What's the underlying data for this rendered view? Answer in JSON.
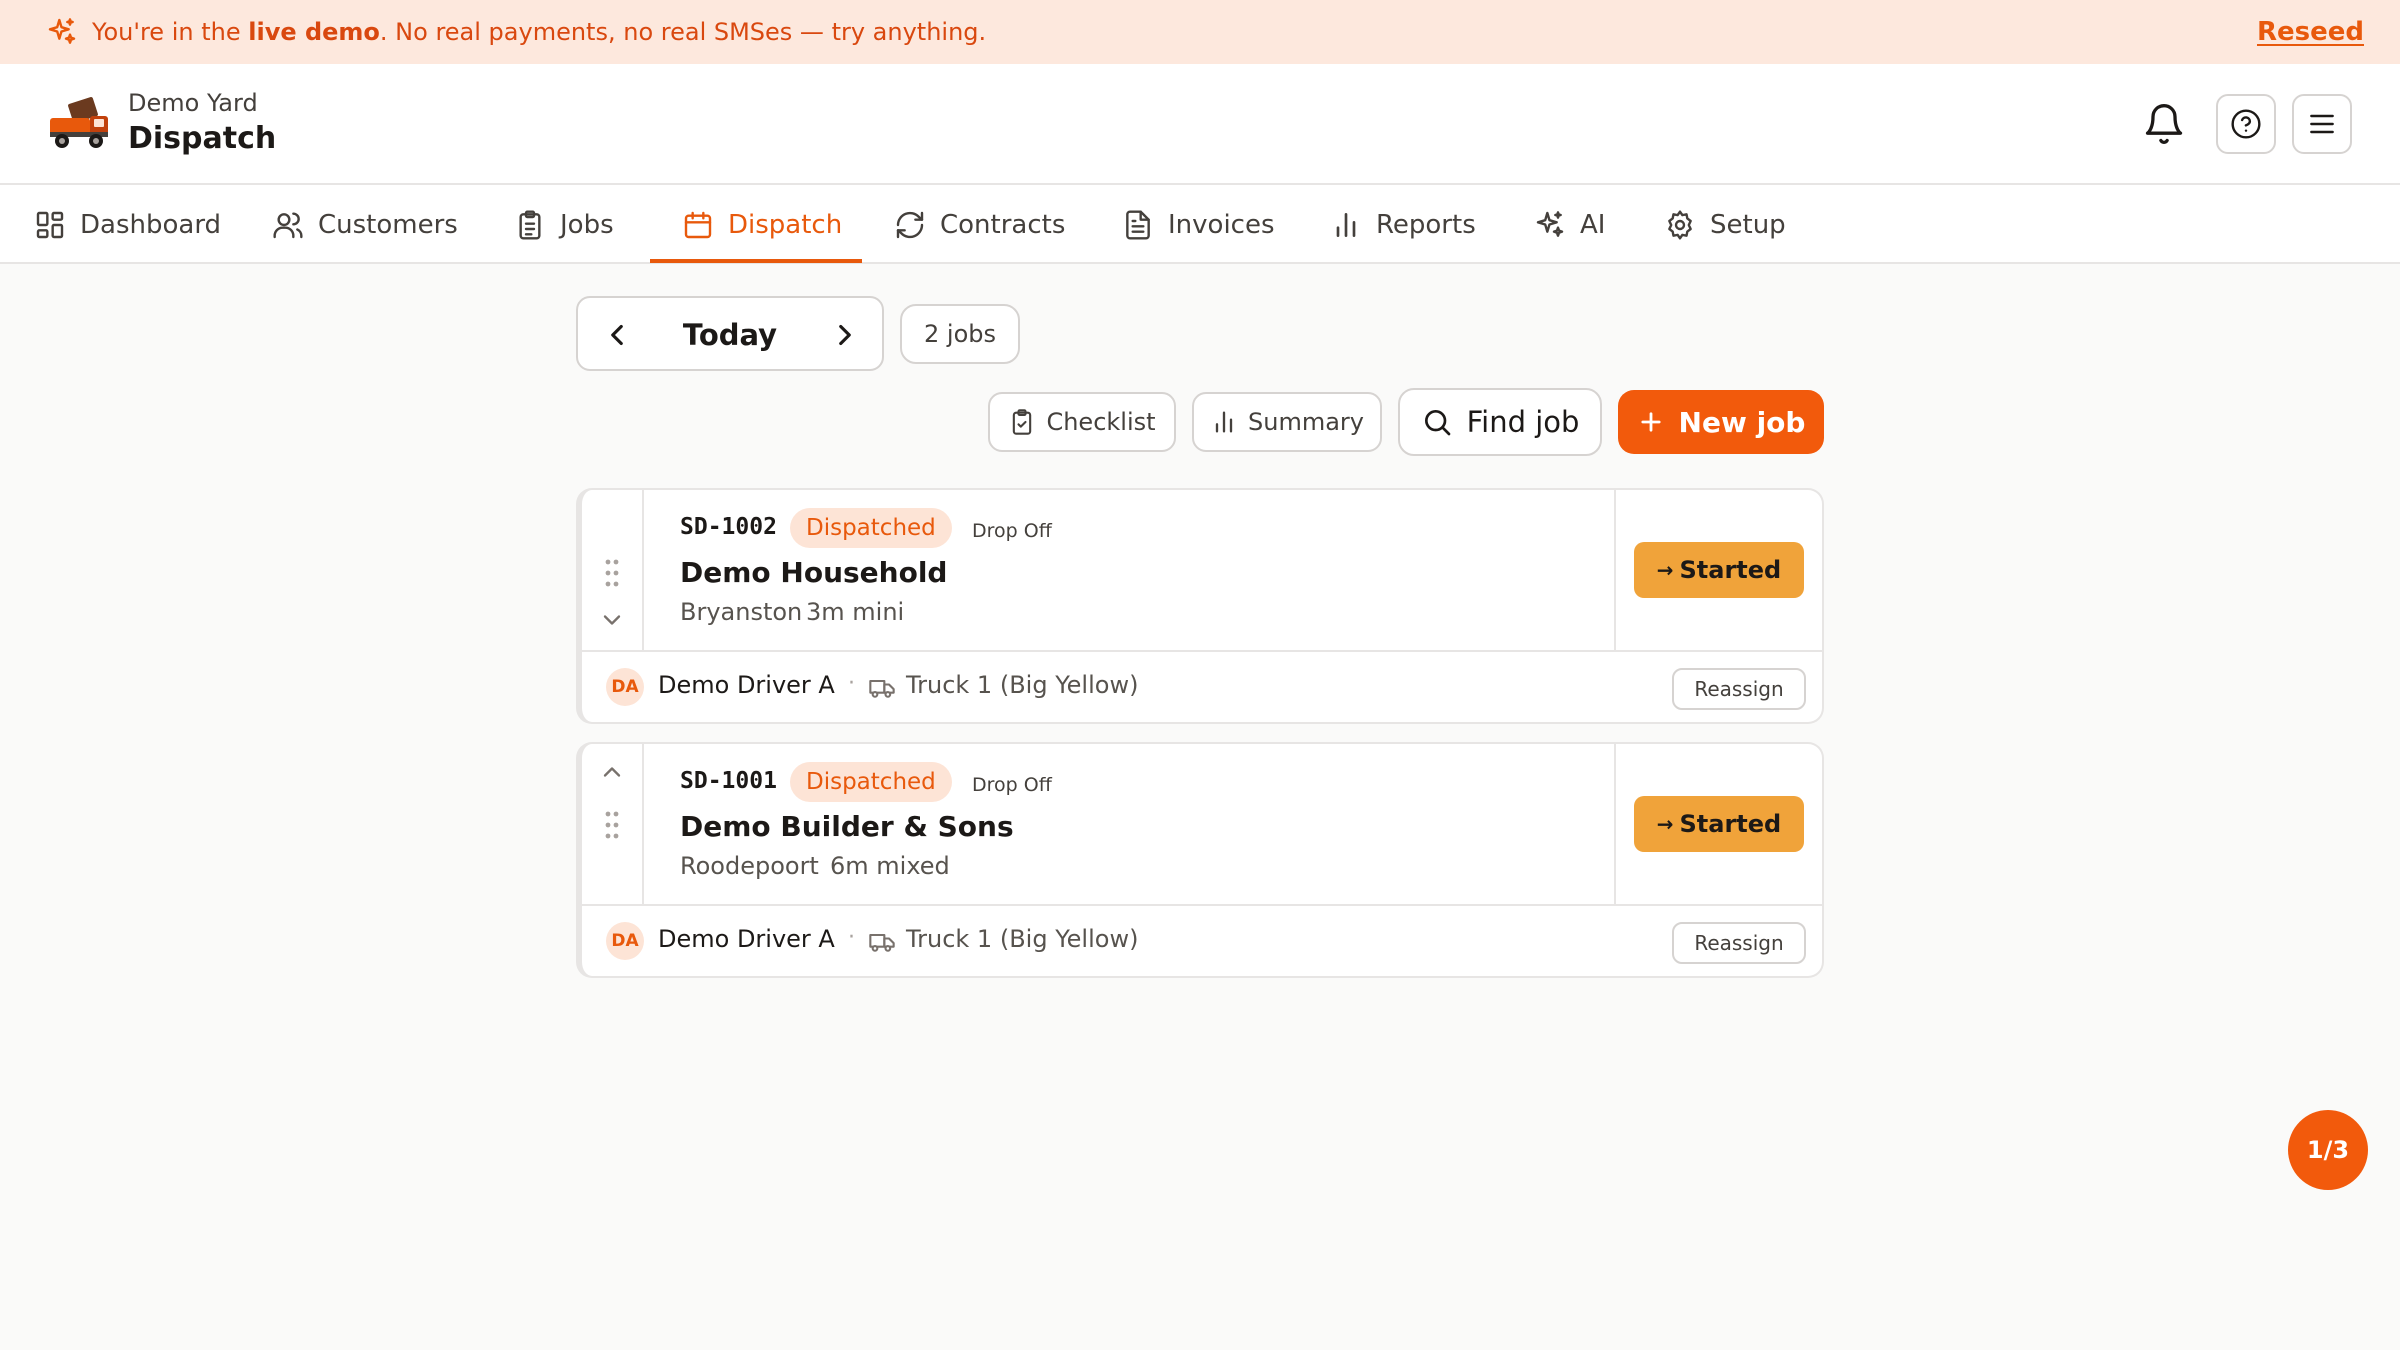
{
  "banner": {
    "prefix": "You're in the ",
    "bold": "live demo",
    "suffix": ". No real payments, no real SMSes — try anything.",
    "reseed": "Reseed"
  },
  "header": {
    "yard": "Demo Yard",
    "title": "Dispatch"
  },
  "nav": [
    {
      "label": "Dashboard",
      "icon": "dashboard-icon"
    },
    {
      "label": "Customers",
      "icon": "users-icon"
    },
    {
      "label": "Jobs",
      "icon": "clipboard-icon"
    },
    {
      "label": "Dispatch",
      "icon": "calendar-icon",
      "active": true
    },
    {
      "label": "Contracts",
      "icon": "refresh-icon"
    },
    {
      "label": "Invoices",
      "icon": "document-icon"
    },
    {
      "label": "Reports",
      "icon": "bar-chart-icon"
    },
    {
      "label": "AI",
      "icon": "sparkles-icon"
    },
    {
      "label": "Setup",
      "icon": "gear-icon"
    }
  ],
  "date": {
    "label": "Today",
    "jobs_count": "2 jobs"
  },
  "toolbar": {
    "checklist": "Checklist",
    "summary": "Summary",
    "find_job": "Find job",
    "new_job": "New job"
  },
  "jobs": [
    {
      "id": "SD-1002",
      "status": "Dispatched",
      "type": "Drop Off",
      "customer": "Demo Household",
      "location": "Bryanston",
      "size": "3m mini",
      "action": "Started",
      "driver_initials": "DA",
      "driver": "Demo Driver A",
      "truck": "Truck 1 (Big Yellow)",
      "reassign": "Reassign"
    },
    {
      "id": "SD-1001",
      "status": "Dispatched",
      "type": "Drop Off",
      "customer": "Demo Builder & Sons",
      "location": "Roodepoort",
      "size": "6m mixed",
      "action": "Started",
      "driver_initials": "DA",
      "driver": "Demo Driver A",
      "truck": "Truck 1 (Big Yellow)",
      "reassign": "Reassign"
    }
  ],
  "pager": "1/3",
  "colors": {
    "accent": "#f25a0c",
    "banner_bg": "#fde8dd",
    "started_btn": "#f0a33a",
    "status_bg": "#fde4d6"
  }
}
